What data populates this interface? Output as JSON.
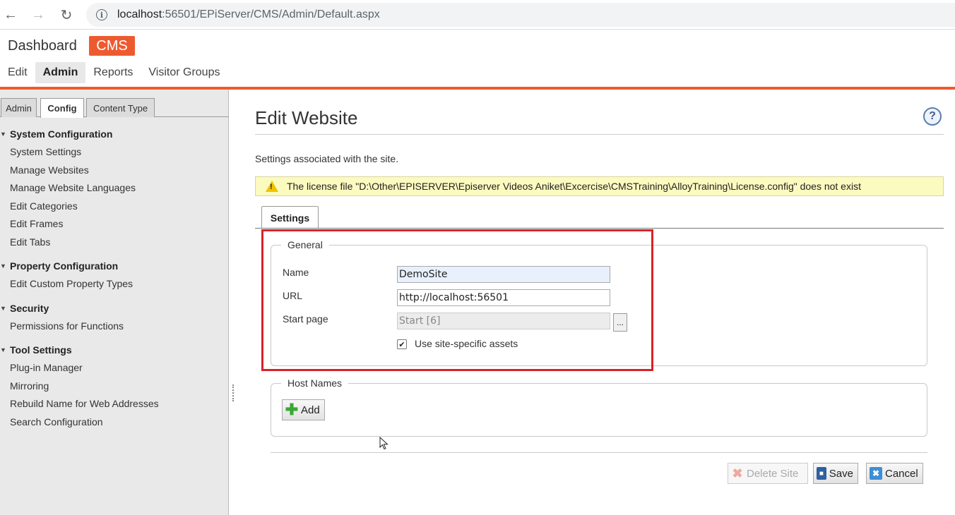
{
  "browser": {
    "url_host": "localhost",
    "url_rest": ":56501/EPiServer/CMS/Admin/Default.aspx"
  },
  "header": {
    "dashboard": "Dashboard",
    "cms_badge": "CMS",
    "nav": [
      "Edit",
      "Admin",
      "Reports",
      "Visitor Groups"
    ],
    "active_nav": "Admin",
    "accent_color": "#ee5a2f"
  },
  "sidebar": {
    "tabs": [
      "Admin",
      "Config",
      "Content Type"
    ],
    "active_tab": "Config",
    "groups": [
      {
        "title": "System Configuration",
        "items": [
          "System Settings",
          "Manage Websites",
          "Manage Website Languages",
          "Edit Categories",
          "Edit Frames",
          "Edit Tabs"
        ]
      },
      {
        "title": "Property Configuration",
        "items": [
          "Edit Custom Property Types"
        ]
      },
      {
        "title": "Security",
        "items": [
          "Permissions for Functions"
        ]
      },
      {
        "title": "Tool Settings",
        "items": [
          "Plug-in Manager",
          "Mirroring",
          "Rebuild Name for Web Addresses",
          "Search Configuration"
        ]
      }
    ]
  },
  "main": {
    "title": "Edit Website",
    "help_icon": "?",
    "description": "Settings associated with the site.",
    "warning": "The license file \"D:\\Other\\EPISERVER\\Episerver Videos Aniket\\Excercise\\CMSTraining\\AlloyTraining\\License.config\" does not exist",
    "settings_tab": "Settings",
    "general": {
      "legend": "General",
      "name_label": "Name",
      "name_value": "DemoSite",
      "url_label": "URL",
      "url_value": "http://localhost:56501",
      "start_page_label": "Start page",
      "start_page_value": "Start [6]",
      "browse_label": "...",
      "assets_label": "Use site-specific assets",
      "assets_checked": true
    },
    "host_names": {
      "legend": "Host Names",
      "add_label": "Add"
    },
    "actions": {
      "delete_label": "Delete Site",
      "save_label": "Save",
      "cancel_label": "Cancel"
    }
  }
}
